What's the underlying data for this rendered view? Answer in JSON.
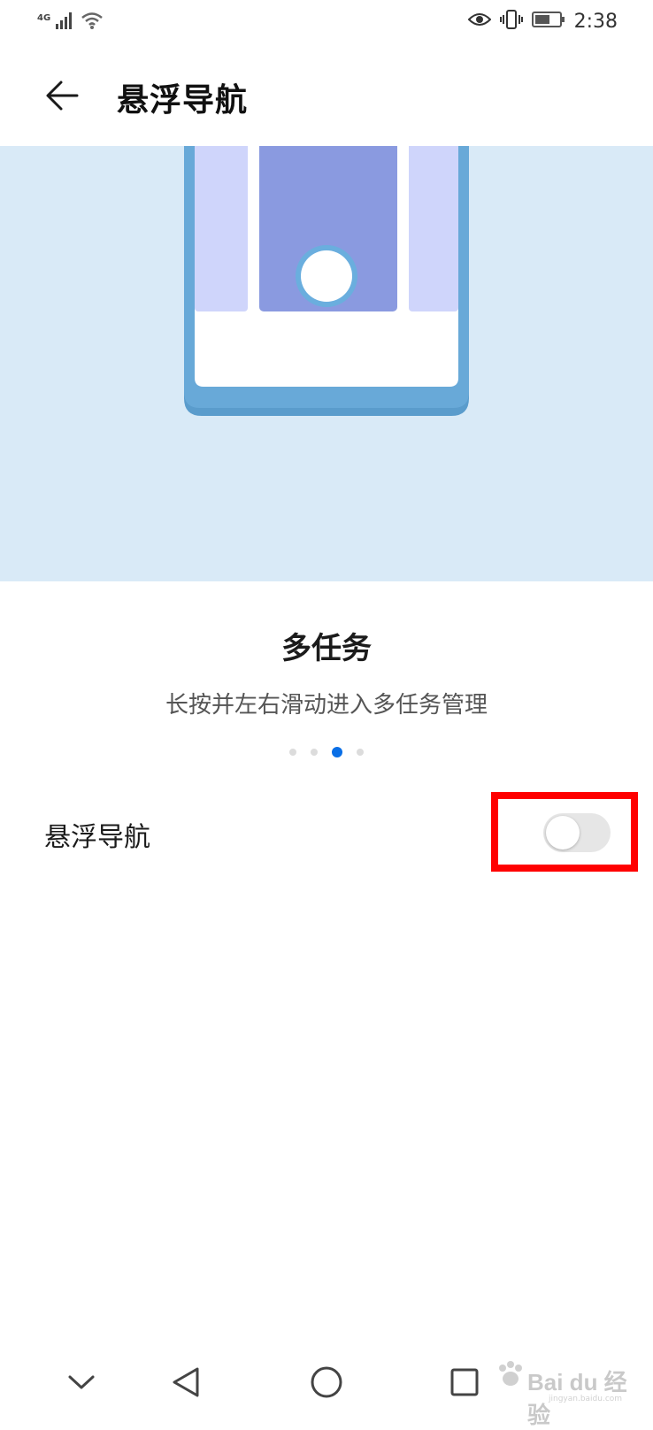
{
  "status_bar": {
    "network": "4G",
    "time": "2:38",
    "icons": [
      "signal-icon",
      "wifi-icon",
      "eye-icon",
      "vibrate-icon",
      "battery-icon"
    ]
  },
  "header": {
    "title": "悬浮导航"
  },
  "card": {
    "title": "多任务",
    "description": "长按并左右滑动进入多任务管理",
    "page_count": 4,
    "active_page": 3
  },
  "setting": {
    "label": "悬浮导航",
    "enabled": false
  },
  "colors": {
    "hero_bg": "#d9eaf7",
    "phone_frame": "#68a9d8",
    "app_card_center": "#8a9ae0",
    "app_card_side": "#cfd5fb",
    "accent": "#0a6fe6",
    "highlight": "#ff0000"
  },
  "nav_bar": {
    "buttons": [
      "chevron-down-icon",
      "back-triangle-icon",
      "home-circle-icon",
      "recents-square-icon"
    ]
  },
  "watermark": {
    "brand": "Bai du 经验",
    "url": "jingyan.baidu.com"
  }
}
